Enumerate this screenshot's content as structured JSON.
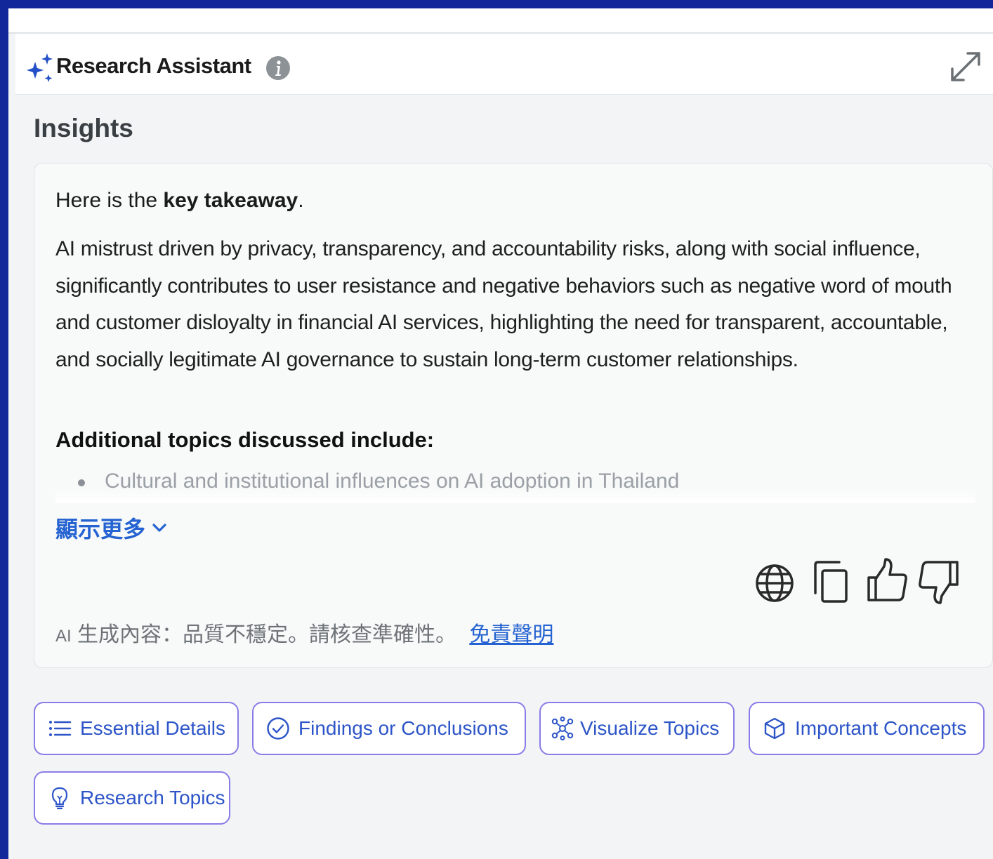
{
  "header": {
    "title": "Research Assistant",
    "icons": {
      "brand": "sparkle-icon",
      "info": "info-icon",
      "expand": "expand-icon"
    }
  },
  "insights": {
    "section_title": "Insights",
    "intro_prefix": "Here is the ",
    "intro_bold": "key takeaway",
    "intro_suffix": ".",
    "takeaway": "AI mistrust driven by privacy, transparency, and accountability risks, along with social influence, significantly contributes to user resistance and negative behaviors such as negative word of mouth and customer disloyalty in financial AI services, highlighting the need for transparent, accountable, and socially legitimate AI governance to sustain long-term customer relationships.",
    "topics_heading": "Additional topics discussed include:",
    "topics": [
      "Cultural and institutional influences on AI adoption in Thailand"
    ],
    "show_more_label": "顯示更多",
    "actions": [
      "globe-icon",
      "copy-icon",
      "thumbs-up-icon",
      "thumbs-down-icon"
    ],
    "disclaimer_ai": "AI",
    "disclaimer_text": "生成內容：品質不穩定。請核查準確性。",
    "disclaimer_link": "免責聲明"
  },
  "chips": [
    {
      "label": "Essential Details",
      "icon": "list-icon"
    },
    {
      "label": "Findings or Conclusions",
      "icon": "check-circle-icon"
    },
    {
      "label": "Visualize Topics",
      "icon": "network-icon"
    },
    {
      "label": "Important Concepts",
      "icon": "cube-icon"
    },
    {
      "label": "Research Topics",
      "icon": "lightbulb-icon"
    }
  ],
  "colors": {
    "frame": "#12279a",
    "panel": "#f2f4f5",
    "accent_link": "#2463d1",
    "chip_border": "#8a7ce8",
    "sparkle": "#2450c8"
  }
}
